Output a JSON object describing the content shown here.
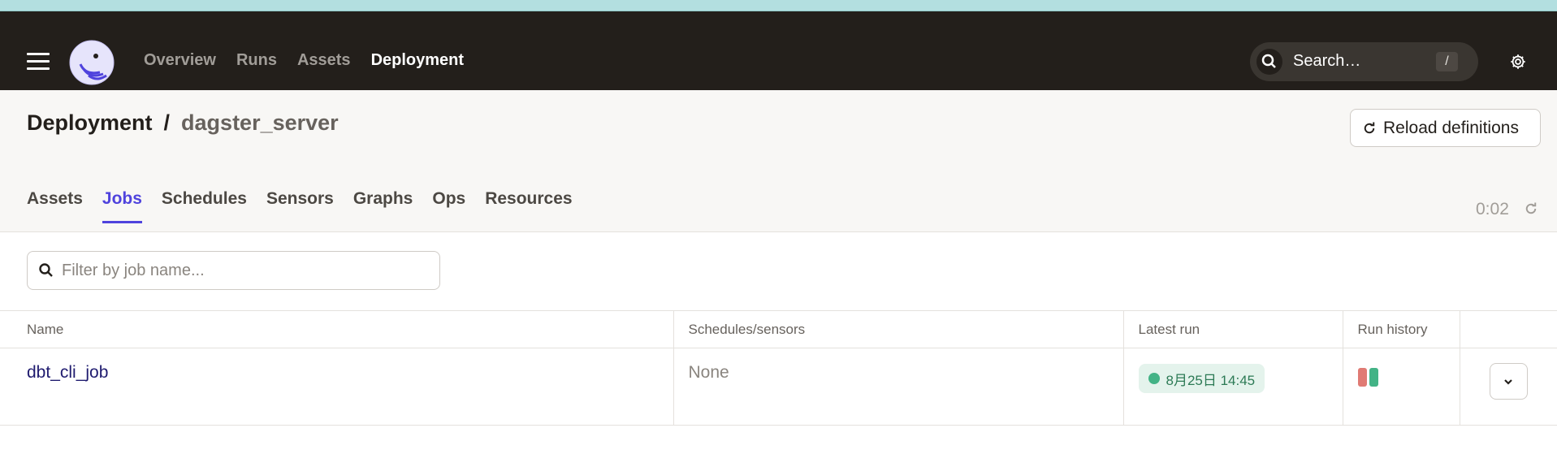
{
  "nav": {
    "links": [
      "Overview",
      "Runs",
      "Assets",
      "Deployment"
    ],
    "active": "Deployment",
    "search_placeholder": "Search…",
    "search_shortcut": "/"
  },
  "header": {
    "crumb_root": "Deployment",
    "crumb_sep": "/",
    "crumb_current": "dagster_server",
    "reload_label": "Reload definitions",
    "tabs": [
      "Assets",
      "Jobs",
      "Schedules",
      "Sensors",
      "Graphs",
      "Ops",
      "Resources"
    ],
    "active_tab": "Jobs",
    "refresh_timer": "0:02"
  },
  "filter": {
    "placeholder": "Filter by job name..."
  },
  "table": {
    "columns": [
      "Name",
      "Schedules/sensors",
      "Latest run",
      "Run history",
      ""
    ],
    "rows": [
      {
        "name": "dbt_cli_job",
        "schedules": "None",
        "latest_run": "8月25日 14:45",
        "latest_run_status": "success",
        "run_history": [
          "failure",
          "success"
        ]
      }
    ]
  },
  "colors": {
    "accent": "#4f43dd",
    "success": "#43b386",
    "failure": "#e07b74",
    "nav_bg": "#231f1b"
  }
}
